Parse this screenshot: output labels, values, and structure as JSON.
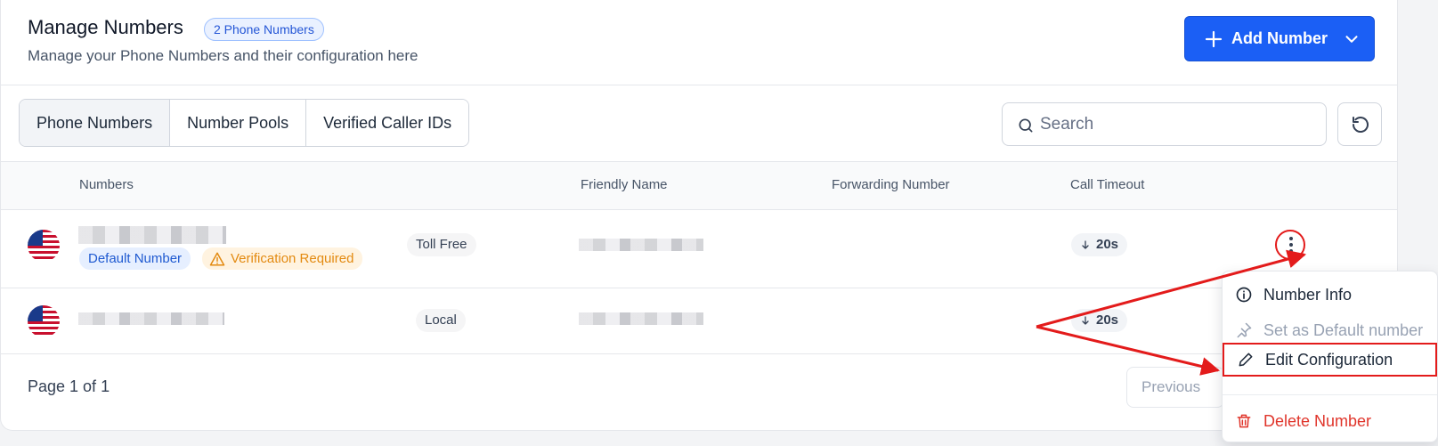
{
  "header": {
    "title": "Manage Numbers",
    "count_badge": "2 Phone Numbers",
    "subtitle": "Manage your Phone Numbers and their configuration here",
    "add_button_label": "Add Number"
  },
  "tabs": [
    {
      "label": "Phone Numbers",
      "active": true
    },
    {
      "label": "Number Pools",
      "active": false
    },
    {
      "label": "Verified Caller IDs",
      "active": false
    }
  ],
  "search": {
    "placeholder": "Search",
    "value": ""
  },
  "table": {
    "columns": [
      "Numbers",
      "Friendly Name",
      "Forwarding Number",
      "Call Timeout"
    ],
    "rows": [
      {
        "badges": [
          "Default Number",
          "Verification Required"
        ],
        "type": "Toll Free",
        "call_timeout": "20s"
      },
      {
        "badges": [],
        "type": "Local",
        "call_timeout": "20s"
      }
    ]
  },
  "footer": {
    "page_text": "Page 1 of 1",
    "prev_label": "Previous"
  },
  "row_menu": {
    "items": [
      {
        "label": "Number Info",
        "icon": "info-icon",
        "state": "normal"
      },
      {
        "label": "Set as Default number",
        "icon": "pin-icon",
        "state": "disabled"
      },
      {
        "label": "Edit Configuration",
        "icon": "pencil-icon",
        "state": "highlighted"
      },
      {
        "label": "Delete Number",
        "icon": "trash-icon",
        "state": "danger"
      }
    ]
  },
  "colors": {
    "primary": "#1b5ff5",
    "danger": "#e31b1b",
    "warning": "#e38a10",
    "annotation": "#e31b1b"
  }
}
